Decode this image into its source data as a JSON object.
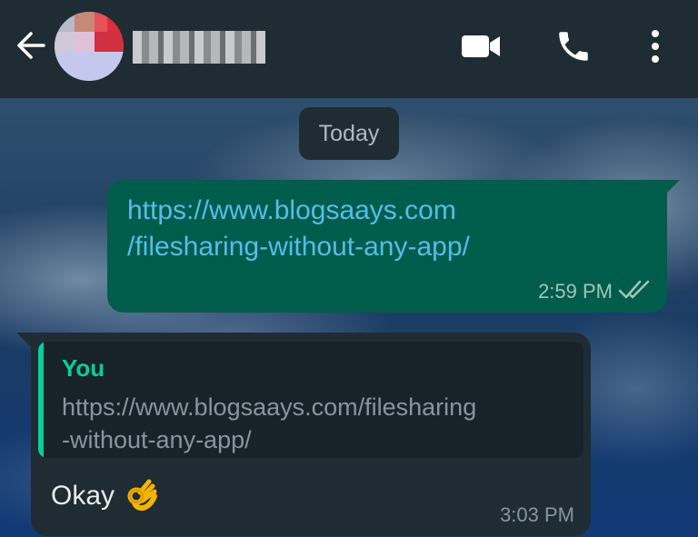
{
  "header": {
    "back_icon": "arrow-left-icon",
    "contact_name": "",
    "actions": [
      "video-call-icon",
      "voice-call-icon",
      "more-vert-icon"
    ]
  },
  "chat": {
    "date_chip": "Today",
    "messages": [
      {
        "direction": "outgoing",
        "text_line1": "https://www.blogsaays.com",
        "text_line2": "/filesharing-without-any-app/",
        "time": "2:59 PM",
        "status": "read"
      },
      {
        "direction": "incoming",
        "quote_author": "You",
        "quote_line1": "https://www.blogsaays.com/filesharing",
        "quote_line2": "-without-any-app/",
        "text": "Okay",
        "emoji": "ok-hand-icon",
        "time": "3:03 PM"
      }
    ]
  },
  "colors": {
    "header_bg": "#1f2c34",
    "outgoing_bubble": "#005c4b",
    "incoming_bubble": "#1f2c34",
    "link": "#53bdeb",
    "quote_accent": "#06cf9c",
    "read_ticks": "#9fc5bb"
  }
}
